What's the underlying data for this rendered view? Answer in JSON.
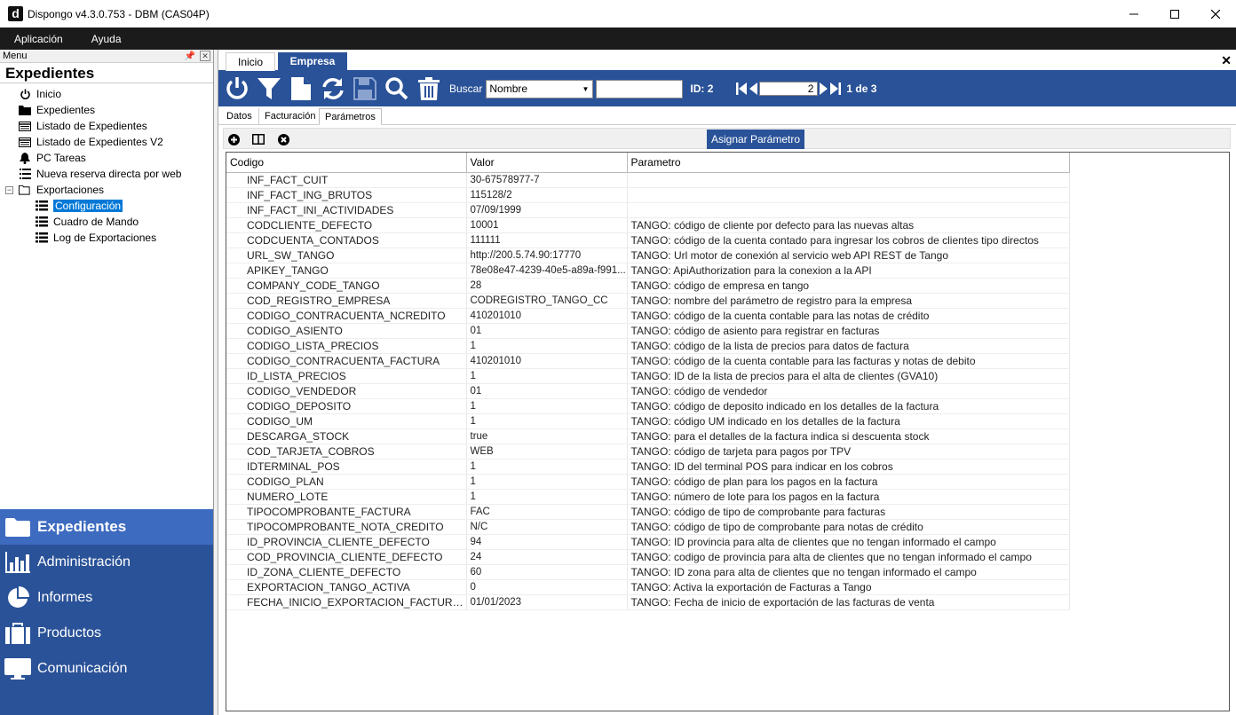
{
  "window": {
    "title": "Dispongo v4.3.0.753 - DBM (CAS04P)",
    "app_icon_letter": "d"
  },
  "menubar": [
    "Aplicación",
    "Ayuda"
  ],
  "left_panel": {
    "caption": "Menu",
    "section_title": "Expedientes",
    "tree": [
      {
        "label": "Inicio",
        "icon": "power-icon",
        "level": 0
      },
      {
        "label": "Expedientes",
        "icon": "folder-icon",
        "level": 0
      },
      {
        "label": "Listado de Expedientes",
        "icon": "list-icon",
        "level": 0
      },
      {
        "label": "Listado de Expedientes V2",
        "icon": "list-icon",
        "level": 0
      },
      {
        "label": "PC Tareas",
        "icon": "bell-icon",
        "level": 0
      },
      {
        "label": "Nueva reserva directa por web",
        "icon": "list-icon",
        "level": 0
      },
      {
        "label": "Exportaciones",
        "icon": "folder-open-icon",
        "level": 0
      },
      {
        "label": "Configuración",
        "icon": "list-icon",
        "level": 1,
        "selected": true
      },
      {
        "label": "Cuadro de Mando",
        "icon": "list-icon",
        "level": 1
      },
      {
        "label": "Log de Exportaciones",
        "icon": "list-icon",
        "level": 1
      }
    ],
    "nav": [
      {
        "label": "Expedientes",
        "icon": "folder-icon",
        "active": true
      },
      {
        "label": "Administración",
        "icon": "bar-chart-icon"
      },
      {
        "label": "Informes",
        "icon": "pie-chart-icon"
      },
      {
        "label": "Productos",
        "icon": "briefcase-icon"
      },
      {
        "label": "Comunicación",
        "icon": "monitor-icon"
      }
    ]
  },
  "doc_tabs": {
    "inactive": "Inicio",
    "active": "Empresa"
  },
  "toolbar": {
    "search_label": "Buscar",
    "search_field": "Nombre",
    "search_value": "",
    "id_label": "ID: 2",
    "page_value": "2",
    "page_of": "1 de 3"
  },
  "sub_tabs": [
    "Datos",
    "Facturación",
    "Parámetros"
  ],
  "grid_toolbar": {
    "assign_label": "Asignar Parámetro"
  },
  "grid": {
    "columns": [
      "Codigo",
      "Valor",
      "Parametro"
    ],
    "rows": [
      [
        "INF_FACT_CUIT",
        "30-67578977-7",
        ""
      ],
      [
        "INF_FACT_ING_BRUTOS",
        "115128/2",
        ""
      ],
      [
        "INF_FACT_INI_ACTIVIDADES",
        "07/09/1999",
        ""
      ],
      [
        "CODCLIENTE_DEFECTO",
        "10001",
        "TANGO: código de cliente por defecto para las nuevas altas"
      ],
      [
        "CODCUENTA_CONTADOS",
        "111111",
        "TANGO: código de la cuenta contado para ingresar los cobros de clientes tipo directos"
      ],
      [
        "URL_SW_TANGO",
        "http://200.5.74.90:17770",
        "TANGO: Url motor de conexión al servicio web API REST de Tango"
      ],
      [
        "APIKEY_TANGO",
        "78e08e47-4239-40e5-a89a-f991...",
        "TANGO: ApiAuthorization para la conexion a la API"
      ],
      [
        "COMPANY_CODE_TANGO",
        "28",
        "TANGO: código de empresa en tango"
      ],
      [
        "COD_REGISTRO_EMPRESA",
        "CODREGISTRO_TANGO_CC",
        "TANGO: nombre del parámetro de registro para la empresa"
      ],
      [
        "CODIGO_CONTRACUENTA_NCREDITO",
        "410201010",
        "TANGO: código de la cuenta contable para las notas de crédito"
      ],
      [
        "CODIGO_ASIENTO",
        "01",
        "TANGO: código de asiento para registrar en facturas"
      ],
      [
        "CODIGO_LISTA_PRECIOS",
        "1",
        "TANGO: código de la lista de precios para datos de factura"
      ],
      [
        "CODIGO_CONTRACUENTA_FACTURA",
        "410201010",
        "TANGO: código de la cuenta contable para las facturas y notas de debito"
      ],
      [
        "ID_LISTA_PRECIOS",
        "1",
        "TANGO: ID de la lista de precios para el alta de clientes (GVA10)"
      ],
      [
        "CODIGO_VENDEDOR",
        "01",
        "TANGO: código de vendedor"
      ],
      [
        "CODIGO_DEPOSITO",
        "1",
        "TANGO: código de deposito indicado en los detalles de la factura"
      ],
      [
        "CODIGO_UM",
        "1",
        "TANGO: código UM indicado en los detalles de la factura"
      ],
      [
        "DESCARGA_STOCK",
        "true",
        "TANGO: para el detalles de la factura indica si descuenta stock"
      ],
      [
        "COD_TARJETA_COBROS",
        "WEB",
        "TANGO: código de tarjeta para pagos por TPV"
      ],
      [
        "IDTERMINAL_POS",
        "1",
        "TANGO: ID del terminal POS para indicar en los cobros"
      ],
      [
        "CODIGO_PLAN",
        "1",
        "TANGO: código de plan para los pagos en la factura"
      ],
      [
        "NUMERO_LOTE",
        "1",
        "TANGO: número de lote para los pagos en la factura"
      ],
      [
        "TIPOCOMPROBANTE_FACTURA",
        "FAC",
        "TANGO: código de tipo de comprobante para facturas"
      ],
      [
        "TIPOCOMPROBANTE_NOTA_CREDITO",
        "N/C",
        "TANGO: código de tipo de comprobante para notas de crédito"
      ],
      [
        "ID_PROVINCIA_CLIENTE_DEFECTO",
        "94",
        "TANGO: ID provincia para alta de clientes que no tengan informado el campo"
      ],
      [
        "COD_PROVINCIA_CLIENTE_DEFECTO",
        "24",
        "TANGO: codigo de provincia para alta de clientes que no tengan informado el campo"
      ],
      [
        "ID_ZONA_CLIENTE_DEFECTO",
        "60",
        "TANGO: ID zona para alta de clientes que no tengan informado el campo"
      ],
      [
        "EXPORTACION_TANGO_ACTIVA",
        "0",
        "TANGO: Activa la exportación de Facturas a Tango"
      ],
      [
        "FECHA_INICIO_EXPORTACION_FACTURAS",
        "01/01/2023",
        "TANGO: Fecha de inicio de exportación de las facturas de venta"
      ]
    ]
  },
  "colors": {
    "accent": "#2a5298",
    "nav_active": "#3d6bc0",
    "selection": "#0078d7"
  }
}
